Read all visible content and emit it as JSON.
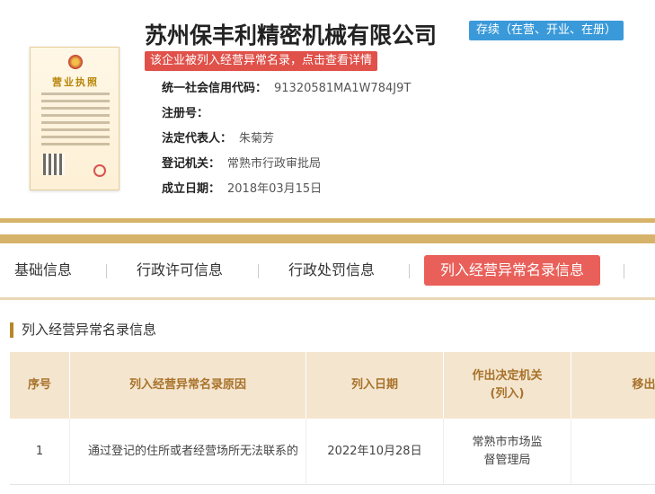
{
  "header": {
    "company_name": "苏州保丰利精密机械有限公司",
    "status": "存续（在营、开业、在册）",
    "alert": "该企业被列入经营异常名录，点击查看详情",
    "license_title": "营业执照"
  },
  "info": {
    "credit_code_label": "统一社会信用代码：",
    "credit_code": "91320581MA1W784J9T",
    "reg_no_label": "注册号：",
    "reg_no": "",
    "legal_rep_label": "法定代表人：",
    "legal_rep": "朱菊芳",
    "authority_label": "登记机关：",
    "authority": "常熟市行政审批局",
    "founded_label": "成立日期：",
    "founded": "2018年03月15日"
  },
  "tabs": [
    {
      "label": "基础信息"
    },
    {
      "label": "行政许可信息"
    },
    {
      "label": "行政处罚信息"
    },
    {
      "label": "列入经营异常名录信息"
    }
  ],
  "section": {
    "title": "列入经营异常名录信息"
  },
  "table": {
    "headers": [
      "序号",
      "列入经营异常名录原因",
      "列入日期",
      "作出决定机关\n(列入)",
      "移出经"
    ],
    "rows": [
      [
        "1",
        "通过登记的住所或者经营场所无法联系的",
        "2022年10月28日",
        "常熟市市场监督管理局",
        ""
      ]
    ]
  },
  "colors": {
    "accent_gold": "#d6b36a",
    "active_tab": "#e9605a",
    "status_badge": "#3a9ad9",
    "alert": "#e0514a"
  }
}
